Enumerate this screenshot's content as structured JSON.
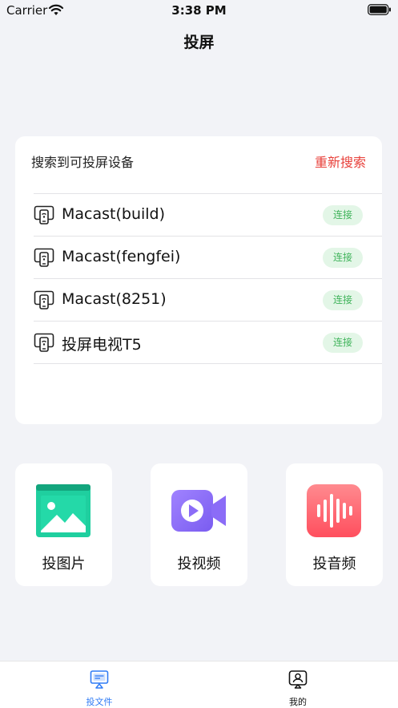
{
  "status_bar": {
    "carrier": "Carrier",
    "time": "3:38 PM"
  },
  "nav": {
    "title": "投屏"
  },
  "device_card": {
    "title": "搜索到可投屏设备",
    "research_label": "重新搜索",
    "devices": [
      {
        "name": "Macast(build)",
        "action": "连接"
      },
      {
        "name": "Macast(fengfei)",
        "action": "连接"
      },
      {
        "name": "Macast(8251)",
        "action": "连接"
      },
      {
        "name": "投屏电视T5",
        "action": "连接"
      }
    ]
  },
  "tiles": [
    {
      "label": "投图片",
      "icon": "image-icon"
    },
    {
      "label": "投视频",
      "icon": "video-icon"
    },
    {
      "label": "投音频",
      "icon": "audio-icon"
    }
  ],
  "tab_bar": {
    "tabs": [
      {
        "label": "投文件",
        "icon": "cast-file-icon",
        "active": true
      },
      {
        "label": "我的",
        "icon": "profile-icon",
        "active": false
      }
    ]
  },
  "colors": {
    "accent_red": "#e8413b",
    "connect_green": "#3fb35a",
    "tab_active": "#2f7bf5",
    "image_tile": "#1fcf9f",
    "video_tile": "#8d6cf6",
    "audio_tile": "#ff5f6d"
  }
}
